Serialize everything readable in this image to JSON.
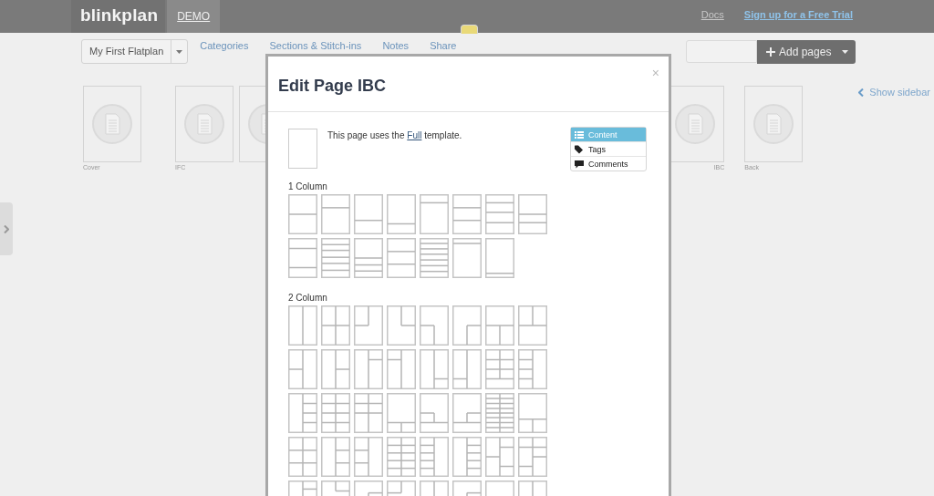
{
  "header": {
    "logo": "blinkplan",
    "nav": [
      {
        "label": "DEMO",
        "selected": true
      }
    ],
    "links": [
      {
        "label": "Docs",
        "kind": "plain"
      },
      {
        "label": "Sign up for a Free Trial",
        "kind": "promo"
      }
    ]
  },
  "toolbar": {
    "flatplan": "My First Flatplan",
    "tabs": [
      "Categories",
      "Sections & Stitch-ins",
      "Notes",
      "Share"
    ],
    "add_button": "Add pages"
  },
  "left_pages": [
    {
      "kind": "page",
      "label": "Cover"
    },
    {
      "kind": "page",
      "label": "IFC"
    },
    {
      "kind": "page"
    }
  ],
  "right_pages": [
    {
      "kind": "page",
      "label": "IBC"
    },
    {
      "kind": "page",
      "label": "Back"
    }
  ],
  "sidebar_link": "Show sidebar",
  "modal": {
    "title": "Edit Page IBC",
    "close": "×",
    "note_before": "This page uses the ",
    "template_link": "Full",
    "note_after": " template.",
    "menu": [
      {
        "label": "Content",
        "kind": "list",
        "selected": true
      },
      {
        "label": "Tags",
        "kind": "tag",
        "selected": false
      },
      {
        "label": "Comments",
        "kind": "comment",
        "selected": false
      }
    ],
    "template_groups": [
      {
        "label": "1 Column"
      },
      {
        "label": "2 Column"
      }
    ]
  }
}
